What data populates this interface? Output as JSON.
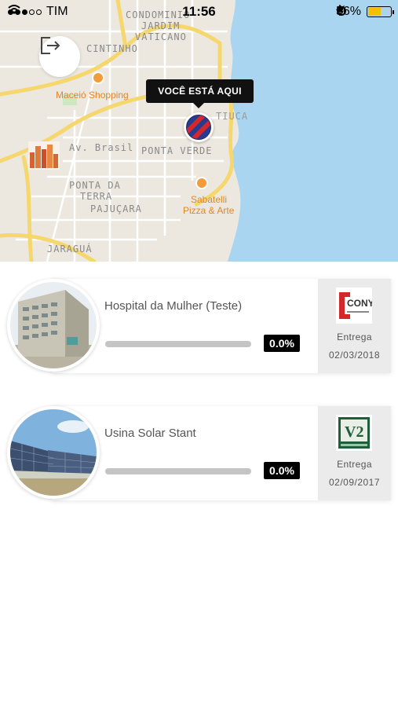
{
  "status_bar": {
    "carrier": "TIM",
    "time": "11:56",
    "battery_percent": "56%",
    "battery_level": 0.56,
    "signal_bars_filled": 3,
    "signal_bars_total": 5
  },
  "map": {
    "labels": {
      "condominio": "CONDOMINIO",
      "jardim": "JARDIM",
      "vaticano": "VATICANO",
      "cintinho": "CINTINHO",
      "maceio_shopping": "Maceió Shopping",
      "av_brasil": "Av. Brasil",
      "ponta_verde": "PONTA VERDE",
      "ponta_da": "PONTA DA",
      "terra": "TERRA",
      "pajucara": "PAJUÇARA",
      "sabatelli_1": "Sabatelli",
      "sabatelli_2": "Pizza & Arte",
      "jaragua": "JARAGUÁ",
      "tiuca_fragment": "TIUCA"
    },
    "tooltip": "VOCÊ ESTÁ AQUI",
    "colors": {
      "water": "#a9d5f0",
      "land": "#ece8df",
      "road_major": "#f5d76e",
      "poi": "#f39c3c"
    }
  },
  "projects": [
    {
      "title": "Hospital da Mulher (Teste)",
      "progress_text": "0.0%",
      "progress_value": 0.0,
      "delivery_label": "Entrega",
      "delivery_date": "02/03/2018",
      "company_logo_text": "CONY",
      "photo": "hospital-building"
    },
    {
      "title": "Usina Solar Stant",
      "progress_text": "0.0%",
      "progress_value": 0.0,
      "delivery_label": "Entrega",
      "delivery_date": "02/09/2017",
      "company_logo_text": "V2",
      "photo": "solar-panels"
    }
  ]
}
